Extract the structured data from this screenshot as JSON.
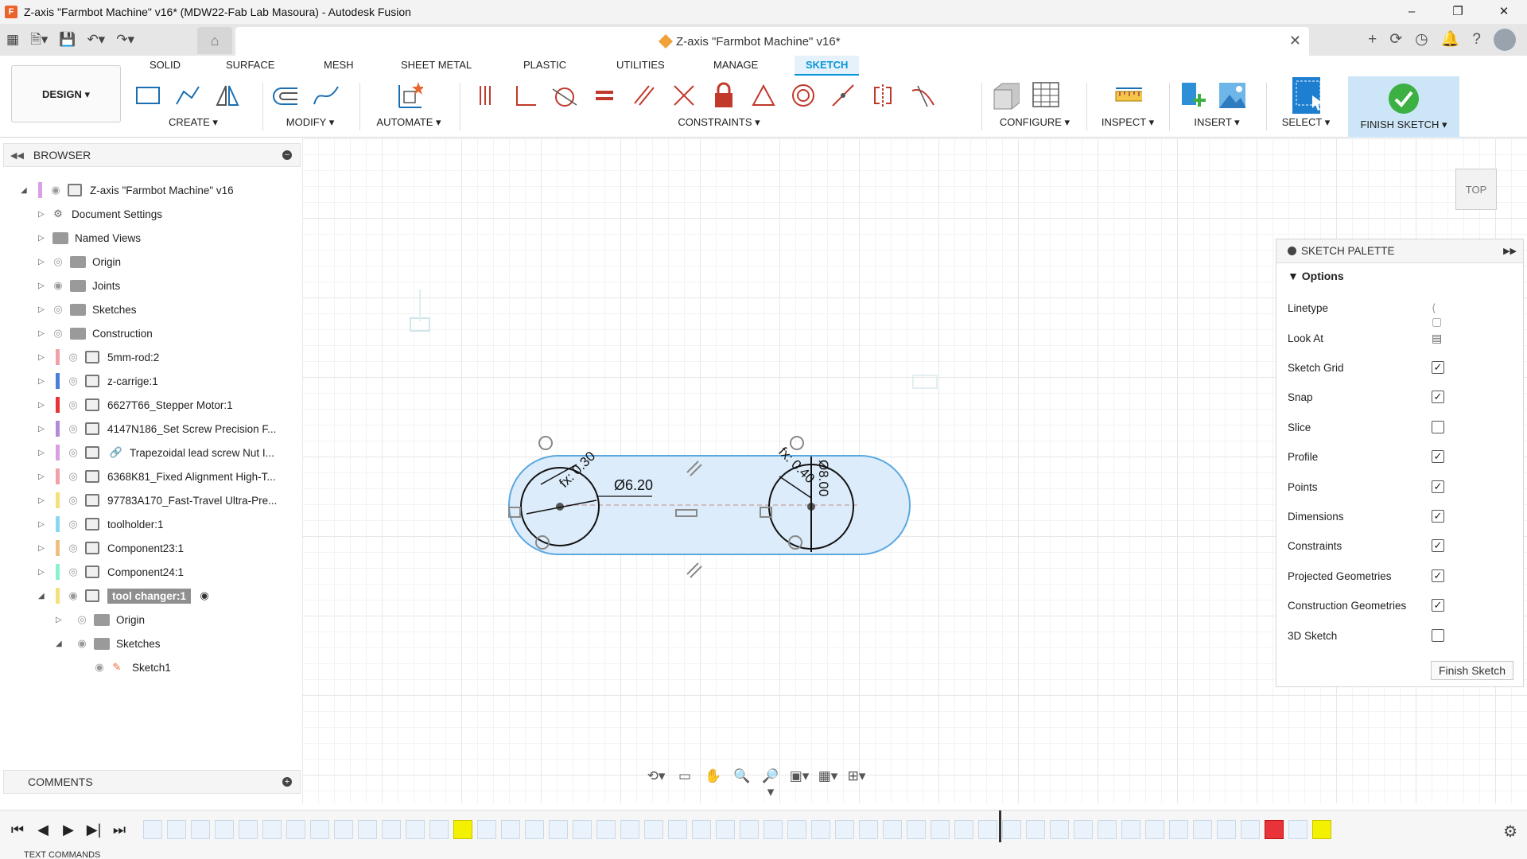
{
  "window": {
    "title": "Z-axis \"Farmbot Machine\" v16* (MDW22-Fab Lab Masoura) - Autodesk Fusion",
    "controls": [
      "–",
      "❐",
      "✕"
    ]
  },
  "document_tab": {
    "title": "Z-axis \"Farmbot Machine\" v16*"
  },
  "ribbon": {
    "workspace": "DESIGN ▾",
    "tabs": [
      "SOLID",
      "SURFACE",
      "MESH",
      "SHEET METAL",
      "PLASTIC",
      "UTILITIES",
      "MANAGE",
      "SKETCH"
    ],
    "active_tab": "SKETCH",
    "groups": {
      "create": "CREATE ▾",
      "modify": "MODIFY ▾",
      "automate": "AUTOMATE ▾",
      "constraints": "CONSTRAINTS ▾",
      "configure": "CONFIGURE ▾",
      "inspect": "INSPECT ▾",
      "insert": "INSERT ▾",
      "select": "SELECT ▾",
      "finish": "FINISH SKETCH ▾"
    }
  },
  "browser": {
    "title": "BROWSER",
    "items": [
      {
        "label": "Z-axis \"Farmbot Machine\" v16"
      },
      {
        "label": "Document Settings"
      },
      {
        "label": "Named Views"
      },
      {
        "label": "Origin"
      },
      {
        "label": "Joints"
      },
      {
        "label": "Sketches"
      },
      {
        "label": "Construction"
      },
      {
        "label": "5mm-rod:2",
        "color": "#f0a0a8"
      },
      {
        "label": "z-carrige:1",
        "color": "#4a7fd8"
      },
      {
        "label": "6627T66_Stepper Motor:1",
        "color": "#e8333b"
      },
      {
        "label": "4147N186_Set Screw Precision F...",
        "color": "#b28ad6"
      },
      {
        "label": "Trapezoidal lead screw Nut I...",
        "color": "#d8a0e0"
      },
      {
        "label": "6368K81_Fixed Alignment High-T...",
        "color": "#f0a0a8"
      },
      {
        "label": "97783A170_Fast-Travel Ultra-Pre...",
        "color": "#f2e27a"
      },
      {
        "label": "toolholder:1",
        "color": "#8ad8f0"
      },
      {
        "label": "Component23:1",
        "color": "#f0c080"
      },
      {
        "label": "Component24:1",
        "color": "#8af0d0"
      },
      {
        "label": "tool changer:1",
        "color": "#f2e27a"
      },
      {
        "label": "Origin"
      },
      {
        "label": "Sketches"
      },
      {
        "label": "Sketch1"
      }
    ]
  },
  "comments": {
    "title": "COMMENTS"
  },
  "sketch": {
    "dim_diameter": "Ø6.20",
    "dim_fx_left": "fx: 0.30",
    "dim_fx_right": "fx: 0.40",
    "dim_right": "Ø8.00"
  },
  "viewcube": {
    "face": "TOP"
  },
  "palette": {
    "title": "SKETCH PALETTE",
    "section": "Options",
    "rows": [
      {
        "label": "Linetype",
        "type": "icon"
      },
      {
        "label": "Look At",
        "type": "icon"
      },
      {
        "label": "Sketch Grid",
        "checked": true
      },
      {
        "label": "Snap",
        "checked": true
      },
      {
        "label": "Slice",
        "checked": false
      },
      {
        "label": "Profile",
        "checked": true
      },
      {
        "label": "Points",
        "checked": true
      },
      {
        "label": "Dimensions",
        "checked": true
      },
      {
        "label": "Constraints",
        "checked": true
      },
      {
        "label": "Projected Geometries",
        "checked": true
      },
      {
        "label": "Construction Geometries",
        "checked": true
      },
      {
        "label": "3D Sketch",
        "checked": false
      }
    ],
    "finish_button": "Finish Sketch"
  },
  "text_commands": "TEXT COMMANDS",
  "colors": {
    "accent": "#0696d7",
    "finish_green": "#3cb043",
    "profile_fill": "#dcecfa"
  }
}
